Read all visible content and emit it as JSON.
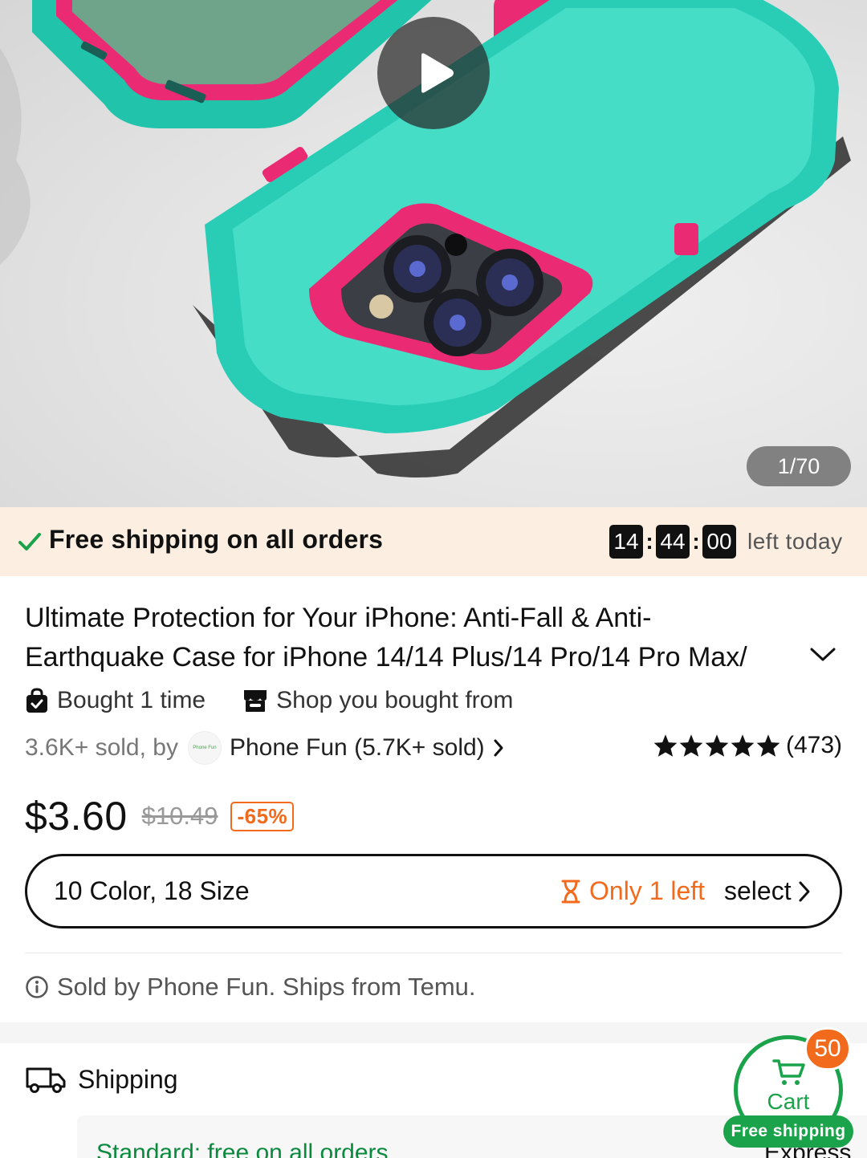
{
  "hero": {
    "image_counter": "1/70",
    "play_icon": "play-icon",
    "colors": {
      "case": "#2fd6bf",
      "accent": "#ea2a73",
      "background": "#e6e6e6"
    }
  },
  "shipping_bar": {
    "text": "Free shipping on all orders",
    "timer": {
      "hours": "14",
      "minutes": "44",
      "seconds": "00",
      "suffix": "left today"
    },
    "colors": {
      "background": "#fcefe2",
      "check": "#1aa34a"
    }
  },
  "product": {
    "title": "Ultimate Protection for Your iPhone: Anti-Fall & Anti-Earthquake Case for iPhone 14/14 Plus/14 Pro/14 Pro Max/",
    "badges": {
      "bought": "Bought 1 time",
      "shop": "Shop you bought from"
    },
    "sold_count": "3.6K+ sold, by",
    "shop_logo_text": "Phone Fun",
    "shop_name": "Phone Fun (5.7K+ sold)",
    "rating_stars": 5,
    "rating_count": "(473)",
    "price": "$3.60",
    "original_price": "$10.49",
    "discount": "-65%",
    "variants": "10 Color, 18 Size",
    "stock": "Only 1 left",
    "select_label": "select",
    "sold_by": "Sold by Phone Fun. Ships from Temu."
  },
  "shipping": {
    "heading": "Shipping",
    "standard": "Standard: free on all orders",
    "express": "Express"
  },
  "cart": {
    "count": "50",
    "label": "Cart",
    "free_shipping": "Free shipping",
    "colors": {
      "green": "#1aa34a",
      "badge": "#f26b1d"
    }
  }
}
